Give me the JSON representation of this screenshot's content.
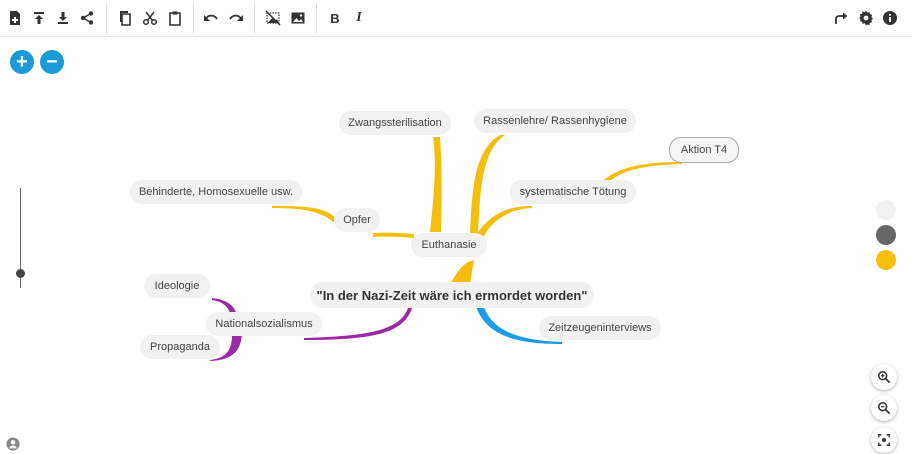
{
  "toolbar": {
    "bold_label": "B",
    "italic_label": "I"
  },
  "canvas": {
    "zoom_in_label": "+",
    "zoom_out_label": "−"
  },
  "mindmap": {
    "root": "\"In der Nazi-Zeit wäre ich ermordet worden\"",
    "euthanasie": "Euthanasie",
    "zwangssterilisation": "Zwangssterilisation",
    "rassenlehre": "Rassenlehre/ Rassenhygiene",
    "aktion_t4": "Aktion T4",
    "systematische_toetung": "systematische Tötung",
    "behinderte": "Behinderte, Homosexuelle usw.",
    "opfer": "Opfer",
    "ideologie": "Ideologie",
    "nationalsozialismus": "Nationalsozialismus",
    "propaganda": "Propaganda",
    "zeitzeugeninterviews": "Zeitzeugeninterviews"
  },
  "colors": {
    "accent": "#1a9ad6",
    "branch_yellow": "#f5bd0c",
    "branch_purple": "#9b2aa6",
    "branch_blue": "#1e9be8",
    "swatch_white": "#f1f1f1",
    "swatch_gray": "#666666",
    "swatch_yellow": "#f7be0d"
  }
}
